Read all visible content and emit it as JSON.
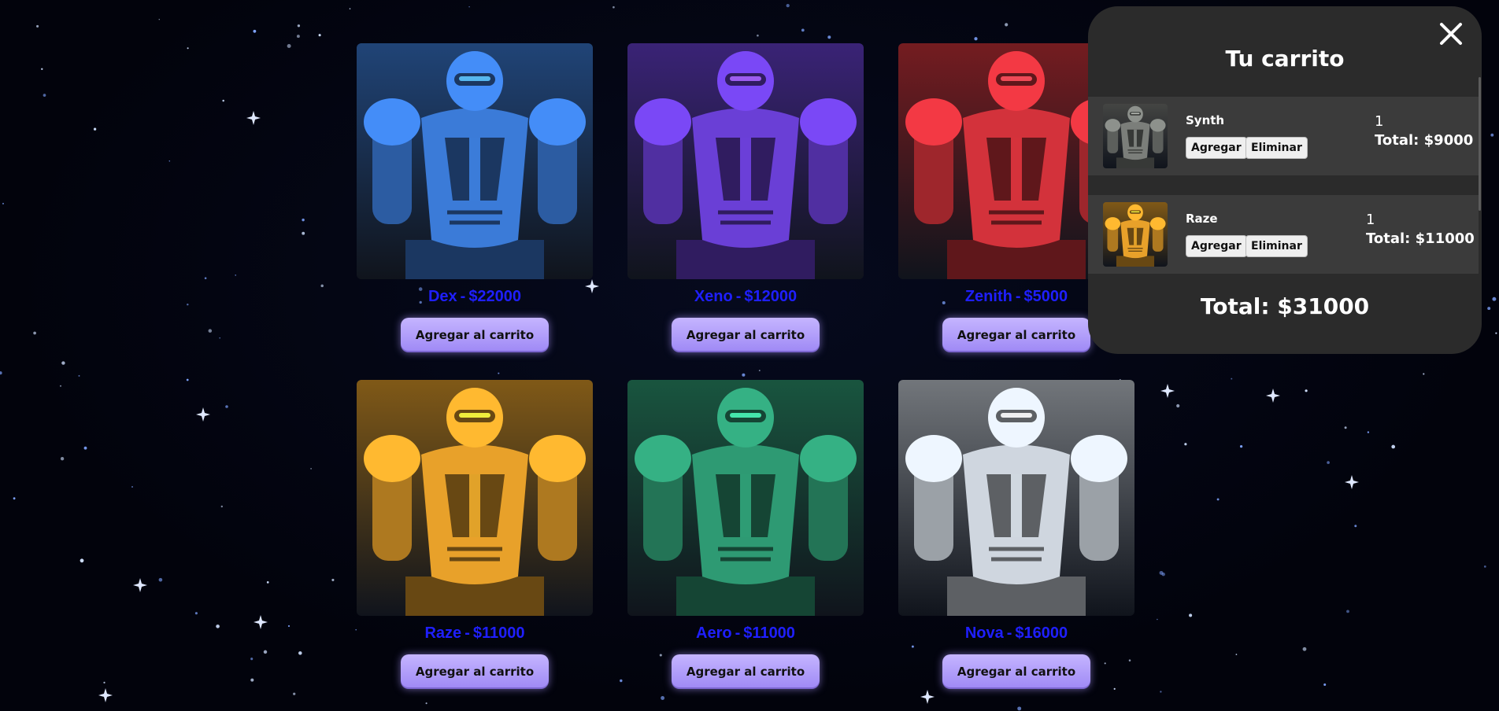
{
  "products": [
    {
      "name": "Dex",
      "price": "$22000",
      "button": "Agregar al carrito",
      "color": "#3b7bd8"
    },
    {
      "name": "Xeno",
      "price": "$12000",
      "button": "Agregar al carrito",
      "color": "#6a3fd6"
    },
    {
      "name": "Zenith",
      "price": "$5000",
      "button": "Agregar al carrito",
      "color": "#d3323b"
    },
    {
      "name": "Raze",
      "price": "$11000",
      "button": "Agregar al carrito",
      "color": "#e8a12a"
    },
    {
      "name": "Aero",
      "price": "$11000",
      "button": "Agregar al carrito",
      "color": "#2e9a73"
    },
    {
      "name": "Nova",
      "price": "$16000",
      "button": "Agregar al carrito",
      "color": "#cfd6df"
    }
  ],
  "price_separator": "-",
  "cart": {
    "title": "Tu carrito",
    "close_icon": "close-icon",
    "items": [
      {
        "name": "Synth",
        "add_label": "Agregar",
        "remove_label": "Eliminar",
        "quantity": "1",
        "total": "Total: $9000",
        "color": "#7b7e7a"
      },
      {
        "name": "Raze",
        "add_label": "Agregar",
        "remove_label": "Eliminar",
        "quantity": "1",
        "total": "Total: $11000",
        "color": "#e8a12a"
      }
    ],
    "grand_total": "Total: $31000"
  },
  "colors": {
    "background": "#02030c",
    "title_text": "#1f1fff",
    "button_bg": "#b3a1ff",
    "cart_bg": "#2b2b2b",
    "cart_row_bg": "#3b3b3b"
  }
}
